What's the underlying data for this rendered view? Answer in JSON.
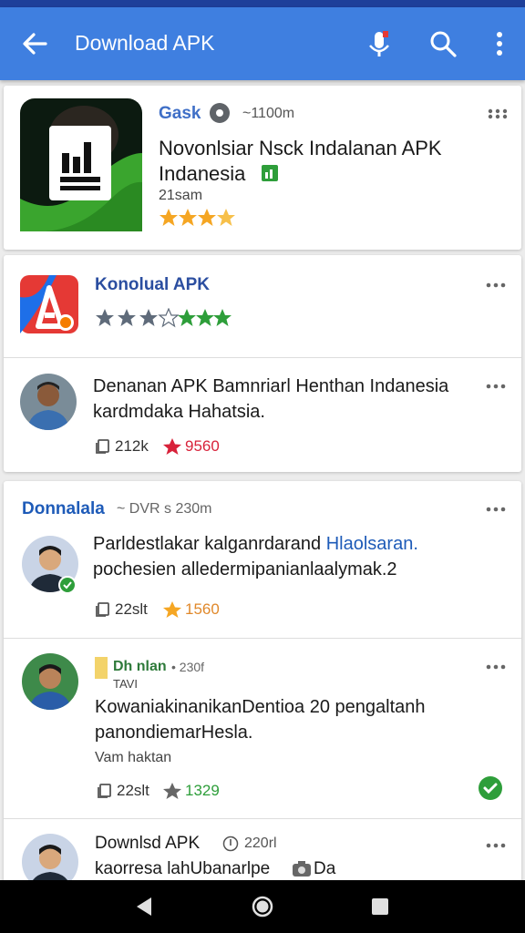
{
  "appbar": {
    "title": "Download APK"
  },
  "card1": {
    "developer": "Gask",
    "size": "~1100m",
    "title_line1": "Novonlsiar Nsck Indalanan APK",
    "title_line2": "Indanesia",
    "meta": "21sam",
    "rating_stars": 3.5
  },
  "card2": {
    "item1": {
      "title": "Konolual APK",
      "rating_stars": 3.5
    },
    "item2": {
      "line1": "Denanan APK Bamnriarl Henthan Indanesia",
      "line2": "kardmdaka Hahatsia.",
      "count": "212k",
      "likes": "9560"
    }
  },
  "card3": {
    "header": "Donnalala",
    "header_meta": "~ DVR s 230m",
    "item1": {
      "line1_plain": "Parldestlakar kalganrdarand",
      "line1_highlight": "Hlaolsaran.",
      "line2": "pochesien alledermipanianlaalymak.2",
      "count": "22slt",
      "rating": "1560"
    },
    "item2": {
      "name": "Dh nlan",
      "name_meta": "• 230f",
      "sub": "TAVI",
      "line1": "KowaniakinanikanDentioa 20 pengaltanh",
      "line2": "panondiemarHesla.",
      "line3": "Vam haktan",
      "count": "22slt",
      "rating": "1329"
    },
    "item3": {
      "title": "Downlsd APK",
      "title_meta": "220rl",
      "line1": "kaorresa lahUbanarlpe",
      "line1_tail": "Da"
    }
  },
  "colors": {
    "appbar": "#3f7fe0",
    "accent_blue": "#1e5bb8",
    "star_gold": "#f5a623",
    "green": "#2e9e3a",
    "red": "#d8223a"
  }
}
